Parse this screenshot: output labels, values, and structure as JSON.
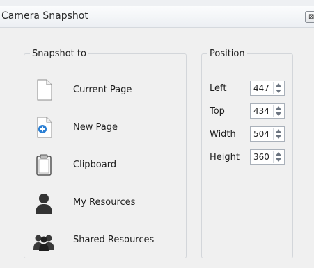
{
  "window": {
    "title": "Camera Snapshot",
    "close_glyph": "⊠"
  },
  "snapshot": {
    "legend": "Snapshot to",
    "items": [
      {
        "label": "Current Page",
        "icon": "page-icon"
      },
      {
        "label": "New Page",
        "icon": "new-page-icon"
      },
      {
        "label": "Clipboard",
        "icon": "clipboard-icon"
      },
      {
        "label": "My Resources",
        "icon": "person-icon"
      },
      {
        "label": "Shared Resources",
        "icon": "people-icon"
      }
    ]
  },
  "position": {
    "legend": "Position",
    "fields": [
      {
        "label": "Left",
        "value": "447"
      },
      {
        "label": "Top",
        "value": "434"
      },
      {
        "label": "Width",
        "value": "504"
      },
      {
        "label": "Height",
        "value": "360"
      }
    ]
  }
}
